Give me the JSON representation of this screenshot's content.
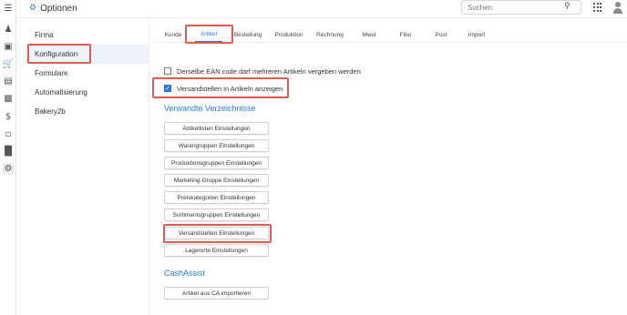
{
  "header": {
    "title": "Optionen",
    "title_icon": "gear-icon",
    "search_placeholder": "Suchen",
    "accent_color": "#2a7ad8"
  },
  "rail": {
    "icons": [
      "menu-icon",
      "user-icon",
      "scan-icon",
      "cart-icon",
      "briefcase-icon",
      "factory-icon",
      "dollar-icon",
      "clipboard-icon",
      "chart-icon",
      "gear-icon"
    ]
  },
  "sidebar": {
    "items": [
      {
        "label": "Firma"
      },
      {
        "label": "Konfiguration",
        "active": true
      },
      {
        "label": "Formulare"
      },
      {
        "label": "Automatisierung"
      },
      {
        "label": "Bakery2b"
      }
    ]
  },
  "tabs": [
    {
      "label": "Kunde"
    },
    {
      "label": "Artikel",
      "active": true
    },
    {
      "label": "Bestellung"
    },
    {
      "label": "Produktion"
    },
    {
      "label": "Rechnung"
    },
    {
      "label": "Mwst"
    },
    {
      "label": "Fibu"
    },
    {
      "label": "Post"
    },
    {
      "label": "Import"
    }
  ],
  "options": {
    "ean_label": "Derselbe EAN code darf mehreren Artikeln vergeben werden",
    "ean_checked": false,
    "versand_label": "Versandstellen in Artikeln anzeigen",
    "versand_checked": true
  },
  "related": {
    "title": "Verwandte Verzeichnisse",
    "buttons": [
      "Artikellisten Einstellungen",
      "Warengruppen Einstellungen",
      "Produktionsgruppen Einstellungen",
      "Marketing-Gruppe Einstellungen",
      "Preiskategorien Einstellungen",
      "Sortimentsgruppen Einstellungen",
      "Versandstellen Einstellungen",
      "Lagerorte Einstellungen"
    ]
  },
  "cashassist": {
    "title": "CashAssist",
    "import_button": "Artikel aus CA importieren"
  },
  "highlight_color": "#e05a4d"
}
